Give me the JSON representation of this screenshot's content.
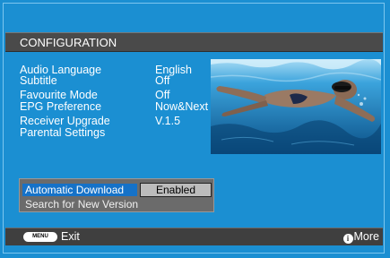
{
  "header": {
    "title": "CONFIGURATION"
  },
  "settings": [
    {
      "label": "Audio Language",
      "value": "English"
    },
    {
      "label": "Subtitle",
      "value": "Off"
    },
    {
      "label": "Favourite Mode",
      "value": "Off"
    },
    {
      "label": "EPG Preference",
      "value": "Now&Next"
    },
    {
      "label": "Receiver Upgrade",
      "value": "V.1.5"
    },
    {
      "label": "Parental Settings",
      "value": ""
    }
  ],
  "preview": {
    "icon": "swimmer-underwater-photo"
  },
  "download": {
    "automatic_label": "Automatic Download",
    "automatic_value": "Enabled",
    "search_label": "Search for New Version"
  },
  "footer": {
    "menu_key": "MENU",
    "exit_label": "Exit",
    "more_label": "More",
    "info_icon": "i"
  },
  "colors": {
    "background": "#1b8fd2",
    "bar": "#4a4a4a",
    "highlight": "#1572c8"
  }
}
